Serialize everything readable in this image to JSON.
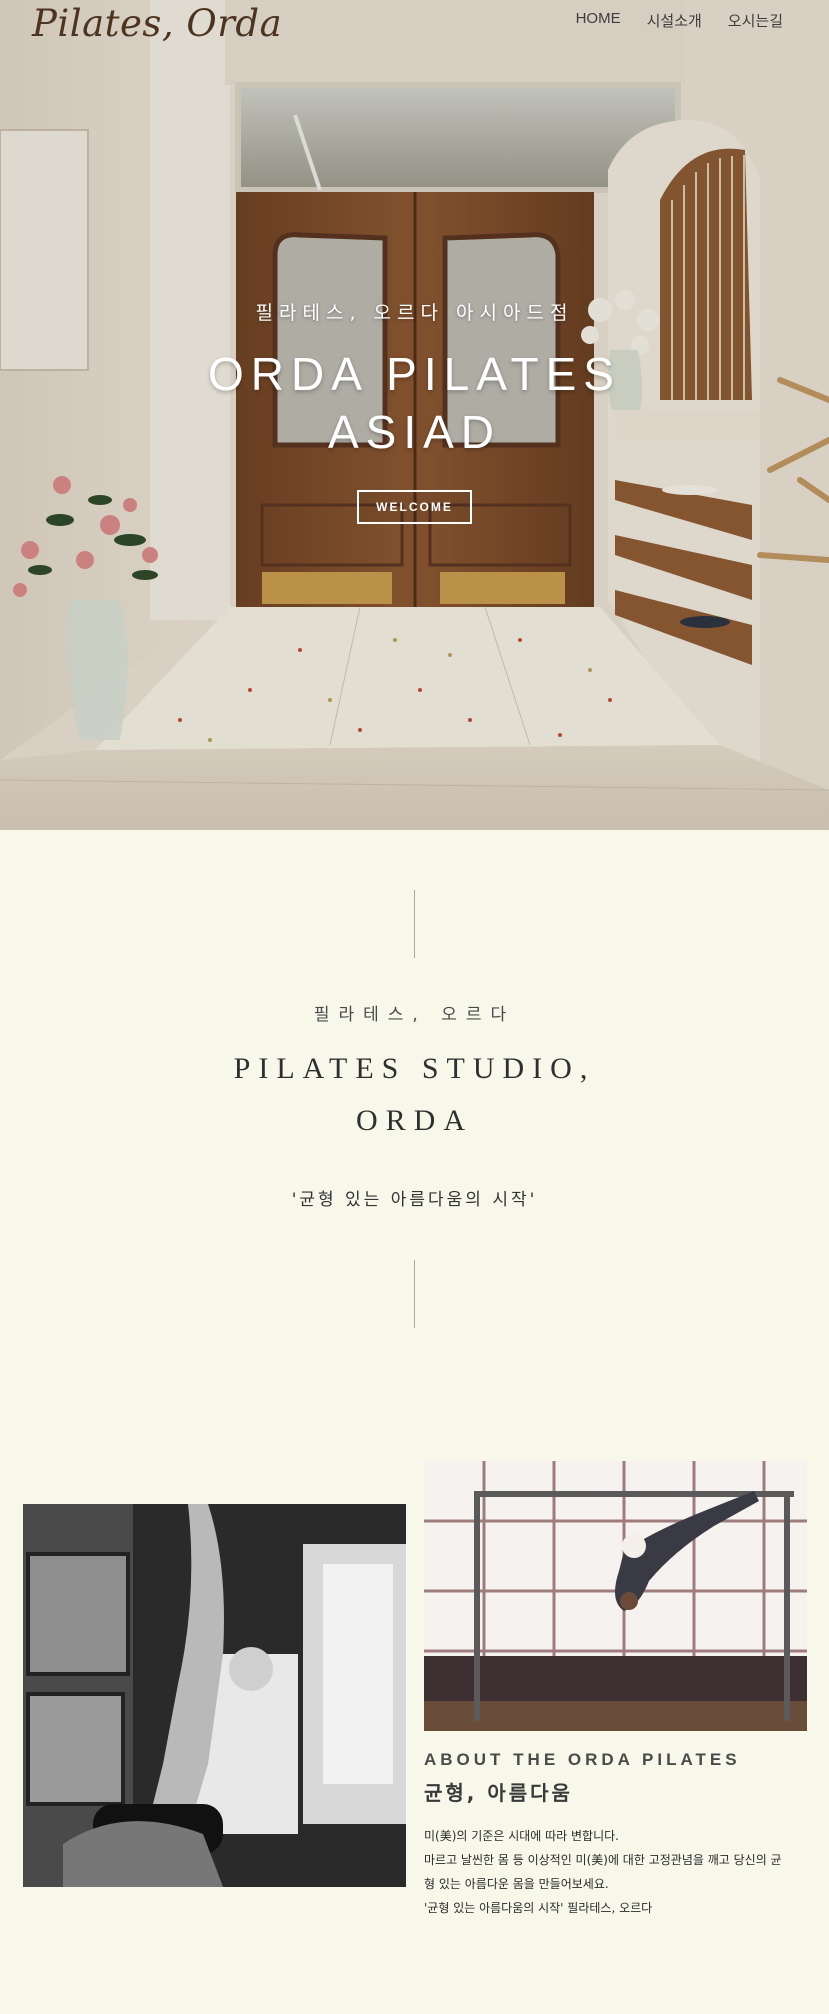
{
  "nav": {
    "logo": "Pilates, Orda",
    "links": [
      "HOME",
      "시설소개",
      "오시는길"
    ]
  },
  "hero": {
    "subtitle": "필라테스, 오르다 아시아드점",
    "title_line1": "ORDA PILATES",
    "title_line2": "ASIAD",
    "button_label": "WELCOME"
  },
  "intro": {
    "kor_label": "필라테스, 오르다",
    "title_line1": "PILATES STUDIO,",
    "title_line2": "ORDA",
    "quote": "'균형 있는 아름다움의 시작'"
  },
  "about": {
    "heading": "ABOUT THE ORDA PILATES",
    "subheading": "균형, 아름다움",
    "body": [
      "미(美)의 기준은 시대에 따라 변합니다.",
      "마르고 날씬한 몸 등 이상적인 미(美)에 대한 고정관념을 깨고 당신의 균",
      "형 있는 아름다운 몸을 만들어보세요.",
      "'균형 있는 아름다움의 시작' 필라테스, 오르다"
    ]
  },
  "colors": {
    "page_bg": "#f7f7ea",
    "logo": "#4d3420",
    "text": "#3a3a3a",
    "divider": "#a9a9a0"
  }
}
